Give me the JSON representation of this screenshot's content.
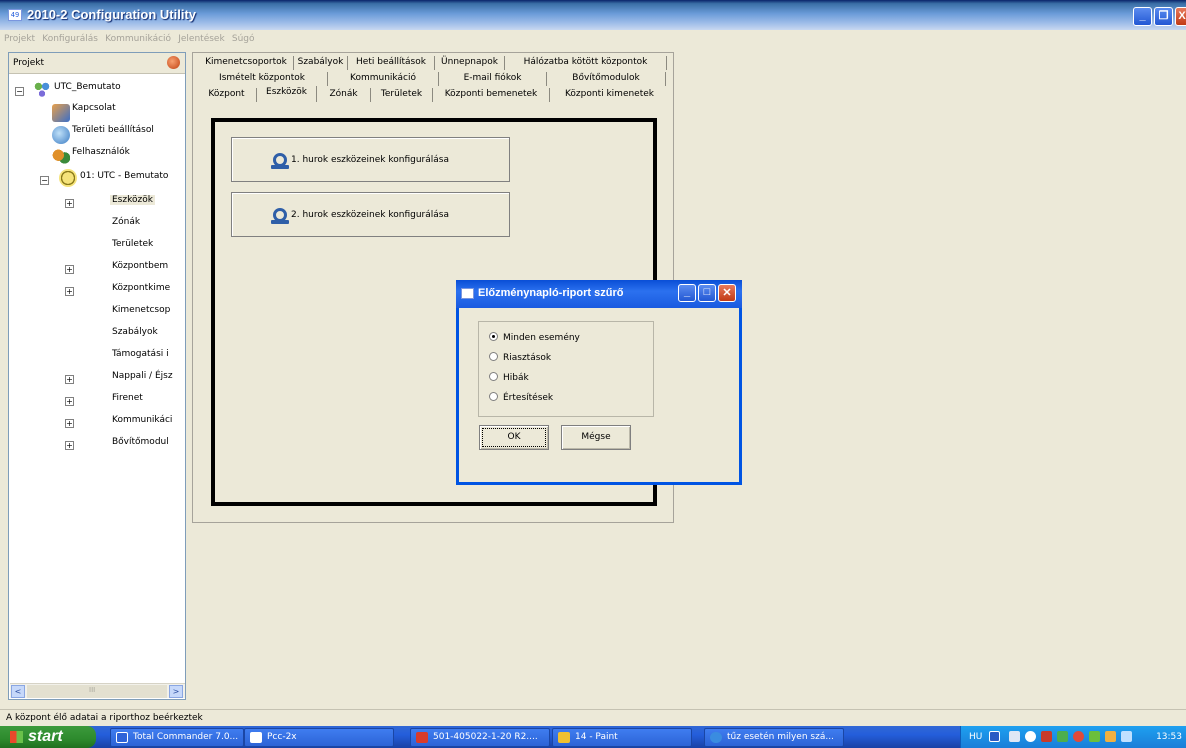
{
  "window": {
    "title": "2010-2 Configuration Utility",
    "app_icon_text": "49"
  },
  "menubar": [
    "Projekt",
    "Konfigurálás",
    "Kommunikáció",
    "Jelentések",
    "Súgó"
  ],
  "left_pane": {
    "header": "Projekt",
    "tree": [
      {
        "label": "UTC_Bemutato"
      },
      {
        "label": "Kapcsolat"
      },
      {
        "label": "Területi beállításol"
      },
      {
        "label": "Felhasználók"
      },
      {
        "label": "01: UTC - Bemutato"
      },
      {
        "label": "Eszközök"
      },
      {
        "label": "Zónák"
      },
      {
        "label": "Területek"
      },
      {
        "label": "Központbem"
      },
      {
        "label": "Központkime"
      },
      {
        "label": "Kimenetcsop"
      },
      {
        "label": "Szabályok"
      },
      {
        "label": "Támogatási i"
      },
      {
        "label": "Nappali / Éjsz"
      },
      {
        "label": "Firenet"
      },
      {
        "label": "Kommunikáci"
      },
      {
        "label": "Bővítőmodul"
      }
    ],
    "expander_plus": "+",
    "expander_minus": "−",
    "scroll_left": "<",
    "scroll_right": ">",
    "scroll_grip": "III"
  },
  "tabs": {
    "row1": [
      "Kimenetcsoportok",
      "Szabályok",
      "Heti beállítások",
      "Ünnepnapok",
      "Hálózatba kötött központok"
    ],
    "row2": [
      "Ismételt központok",
      "Kommunikáció",
      "E-mail fiókok",
      "Bővítőmodulok"
    ],
    "row3": [
      "Központ",
      "Eszközök",
      "Zónák",
      "Területek",
      "Központi bemenetek",
      "Központi kimenetek"
    ],
    "active": "Eszközök"
  },
  "main": {
    "buttons": [
      {
        "label": "1. hurok eszközeinek konfigurálása"
      },
      {
        "label": "2. hurok eszközeinek konfigurálása"
      }
    ]
  },
  "dialog": {
    "title": "Előzménynapló-riport szűrő",
    "options": [
      {
        "label": "Minden esemény",
        "selected": true
      },
      {
        "label": "Riasztások",
        "selected": false
      },
      {
        "label": "Hibák",
        "selected": false
      },
      {
        "label": "Értesítések",
        "selected": false
      }
    ],
    "ok_label": "OK",
    "cancel_label": "Mégse",
    "minimize": "_",
    "maximize": "□",
    "close": "✕"
  },
  "statusbar": {
    "text": "A központ élő adatai a riporthoz beérkeztek"
  },
  "taskbar": {
    "start_label": "start",
    "tasks": [
      {
        "label": "Total Commander 7.0...",
        "icon_color": "#2e63d8"
      },
      {
        "label": "Pcc-2x",
        "icon_color": "#ffffff"
      },
      {
        "label": "501-405022-1-20 R2....",
        "icon_color": "#d93b2b"
      },
      {
        "label": "14 - Paint",
        "icon_color": "#f0c030"
      },
      {
        "label": "tűz esetén milyen szá...",
        "icon_color": "#3a8ce0"
      }
    ],
    "tray": {
      "lang": "HU",
      "clock": "13:53"
    }
  },
  "colors": {
    "titlebar": "#245edb",
    "dialog_border": "#0054e3",
    "panel_bg": "#ece9d8",
    "close_red": "#e04727"
  }
}
